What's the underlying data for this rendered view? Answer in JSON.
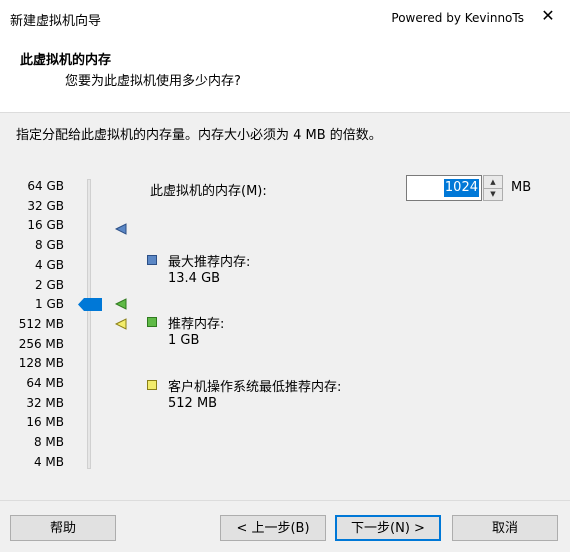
{
  "window": {
    "title": "新建虚拟机向导",
    "powered_by": "Powered by KevinnoTs",
    "close_glyph": "✕"
  },
  "header": {
    "title": "此虚拟机的内存",
    "subtitle": "您要为此虚拟机使用多少内存?"
  },
  "instruction": "指定分配给此虚拟机的内存量。内存大小必须为 4 MB 的倍数。",
  "slider": {
    "labels": [
      "64 GB",
      "32 GB",
      "16 GB",
      "8 GB",
      "4 GB",
      "2 GB",
      "1 GB",
      "512 MB",
      "256 MB",
      "128 MB",
      "64 MB",
      "32 MB",
      "16 MB",
      "8 MB",
      "4 MB"
    ],
    "selected_value": "1 GB",
    "thumb_color": "#0078d7"
  },
  "memory_field": {
    "label": "此虚拟机的内存(M):",
    "value": "1024",
    "unit": "MB"
  },
  "legend": {
    "max": {
      "title": "最大推荐内存:",
      "value": "13.4 GB",
      "color": "#5b87c5"
    },
    "recommended": {
      "title": "推荐内存:",
      "value": "1 GB",
      "color": "#5fba46"
    },
    "min": {
      "title": "客户机操作系统最低推荐内存:",
      "value": "512 MB",
      "color": "#f2ec6b"
    }
  },
  "buttons": {
    "help": "帮助",
    "back": "< 上一步(B)",
    "next": "下一步(N) >",
    "cancel": "取消"
  }
}
